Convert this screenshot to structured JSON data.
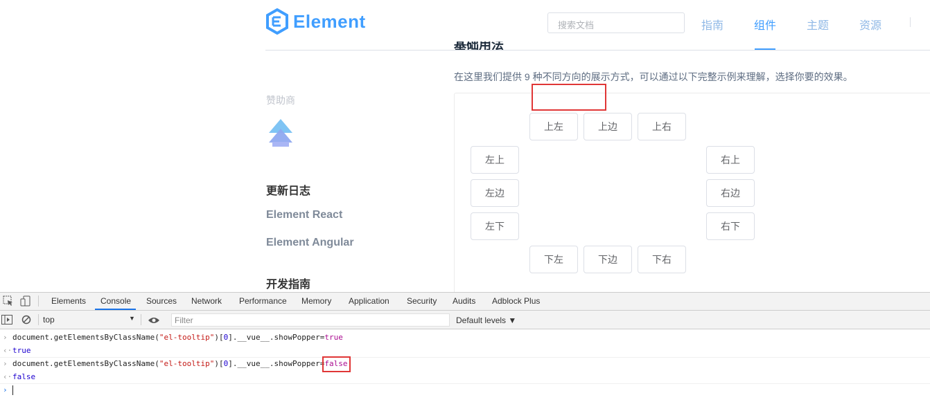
{
  "header": {
    "logo_text": "Element",
    "search_placeholder": "搜索文档",
    "nav": [
      "指南",
      "组件",
      "主题",
      "资源"
    ],
    "active_nav": "组件",
    "brand_color": "#409eff"
  },
  "content": {
    "partial_title": "基础用法",
    "description": "在这里我们提供 9 种不同方向的展示方式，可以通过以下完整示例来理解，选择你要的效果。",
    "buttons": {
      "top_start": "上左",
      "top": "上边",
      "top_end": "上右",
      "left_start": "左上",
      "left": "左边",
      "left_end": "左下",
      "right_start": "右上",
      "right": "右边",
      "right_end": "右下",
      "bottom_start": "下左",
      "bottom": "下边",
      "bottom_end": "下右"
    }
  },
  "sidebar": {
    "sponsor_label": "赞助商",
    "changelog": "更新日志",
    "element_react": "Element React",
    "element_angular": "Element Angular",
    "dev_guide": "开发指南"
  },
  "devtools": {
    "tabs": [
      "Elements",
      "Console",
      "Sources",
      "Network",
      "Performance",
      "Memory",
      "Application",
      "Security",
      "Audits",
      "Adblock Plus"
    ],
    "active_tab": "Console",
    "context": "top",
    "filter_placeholder": "Filter",
    "levels": "Default levels ▼",
    "console": {
      "line1_prefix": "document.getElementsByClassName(",
      "line1_str": "\"el-tooltip\"",
      "line1_mid": ")[",
      "line1_idx": "0",
      "line1_suffix": "].__vue__.showPopper=",
      "line1_val": "true",
      "out1": "true",
      "line2_prefix": "document.getElementsByClassName(",
      "line2_str": "\"el-tooltip\"",
      "line2_mid": ")[",
      "line2_idx": "0",
      "line2_suffix": "].__vue__.showPopper=",
      "line2_val": "false",
      "out2": "false"
    }
  }
}
